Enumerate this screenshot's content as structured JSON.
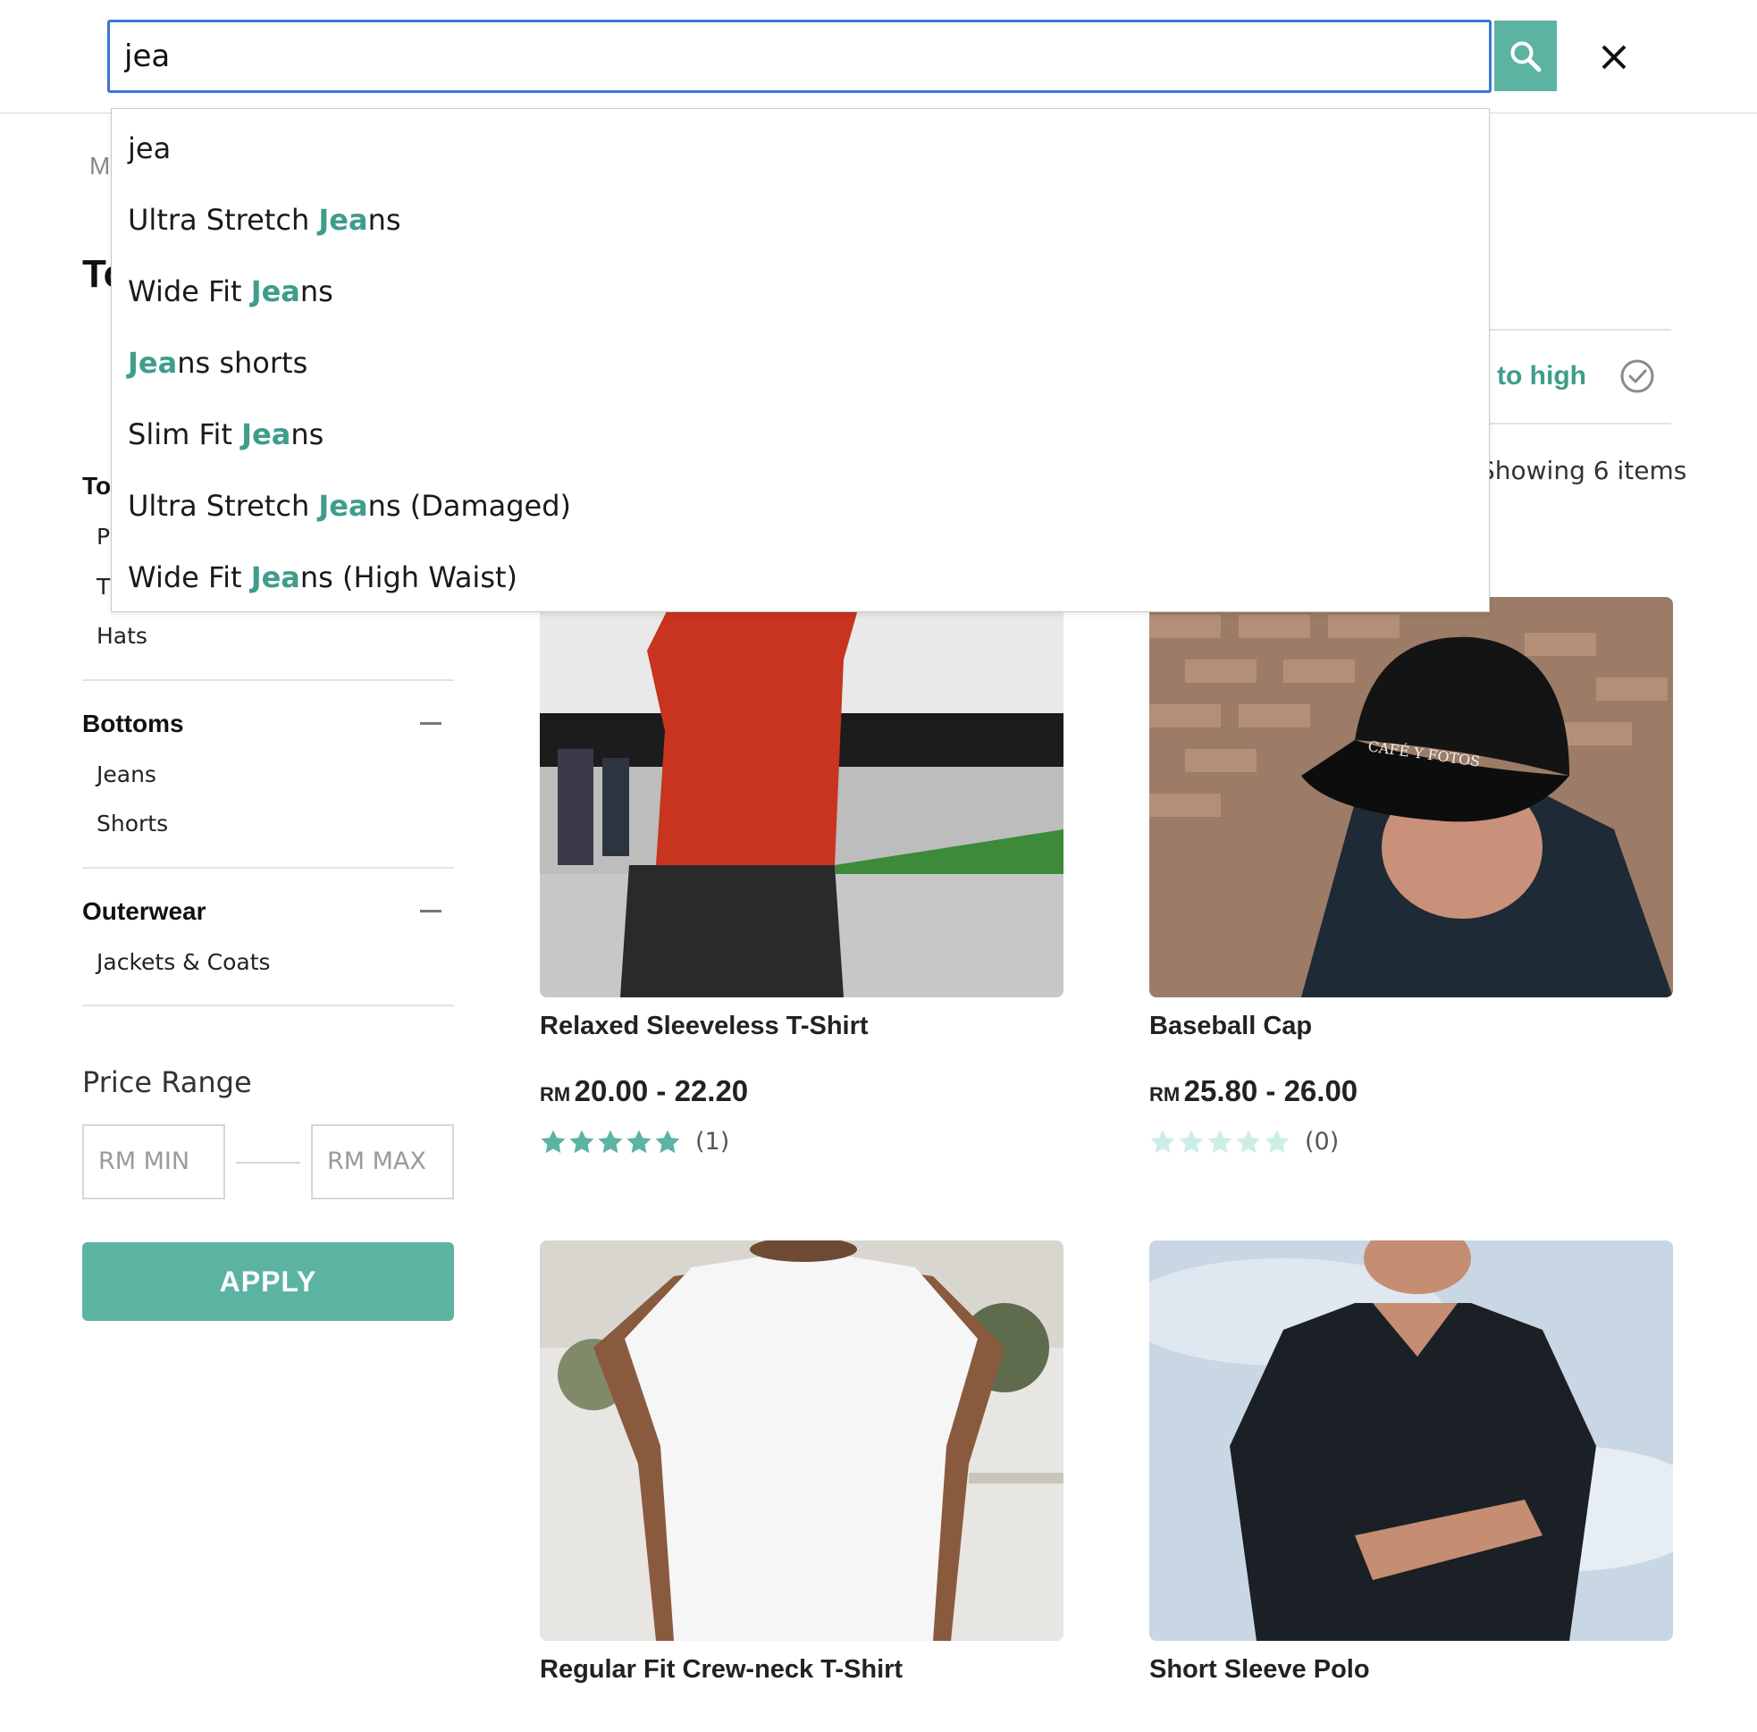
{
  "search": {
    "value": "jea",
    "suggestions": [
      {
        "pre": "",
        "match": "",
        "post": "jea"
      },
      {
        "pre": "Ultra Stretch ",
        "match": "Jea",
        "post": "ns"
      },
      {
        "pre": "Wide Fit ",
        "match": "Jea",
        "post": "ns"
      },
      {
        "pre": "",
        "match": "Jea",
        "post": "ns shorts"
      },
      {
        "pre": "Slim Fit ",
        "match": "Jea",
        "post": "ns"
      },
      {
        "pre": "Ultra Stretch ",
        "match": "Jea",
        "post": "ns (Damaged)"
      },
      {
        "pre": "Wide Fit ",
        "match": "Jea",
        "post": "ns (High Waist)"
      }
    ]
  },
  "sidebar": {
    "breadcrumb_visible": "M",
    "heading_visible": "To",
    "tops": {
      "title_visible": "To",
      "items_visible": [
        "P",
        "T",
        "Hats"
      ]
    },
    "bottoms": {
      "title": "Bottoms",
      "items": [
        "Jeans",
        "Shorts"
      ]
    },
    "outerwear": {
      "title": "Outerwear",
      "items": [
        "Jackets & Coats"
      ]
    },
    "price": {
      "title": "Price Range",
      "min_placeholder": "RM MIN",
      "max_placeholder": "RM MAX",
      "apply_label": "APPLY"
    }
  },
  "sort": {
    "label_visible": "v to high",
    "showing_visible": "Showing 6 items"
  },
  "products": [
    {
      "name": "Relaxed Sleeveless T-Shirt",
      "currency": "RM",
      "price": "20.00 - 22.20",
      "stars": 5,
      "reviews": "(1)"
    },
    {
      "name": "Baseball Cap",
      "currency": "RM",
      "price": "25.80 - 26.00",
      "stars": 0,
      "reviews": "(0)"
    },
    {
      "name": "Regular Fit Crew-neck T-Shirt"
    },
    {
      "name": "Short Sleeve Polo"
    }
  ],
  "colors": {
    "accent": "#5cb3a2",
    "accent_text": "#3f9d8c",
    "focus": "#3b76d6",
    "star_empty": "#cdeee7"
  },
  "icons": {
    "search": "search-icon",
    "close": "close-icon",
    "check": "check-circle-icon",
    "star": "star-icon",
    "collapse": "minus-icon"
  }
}
